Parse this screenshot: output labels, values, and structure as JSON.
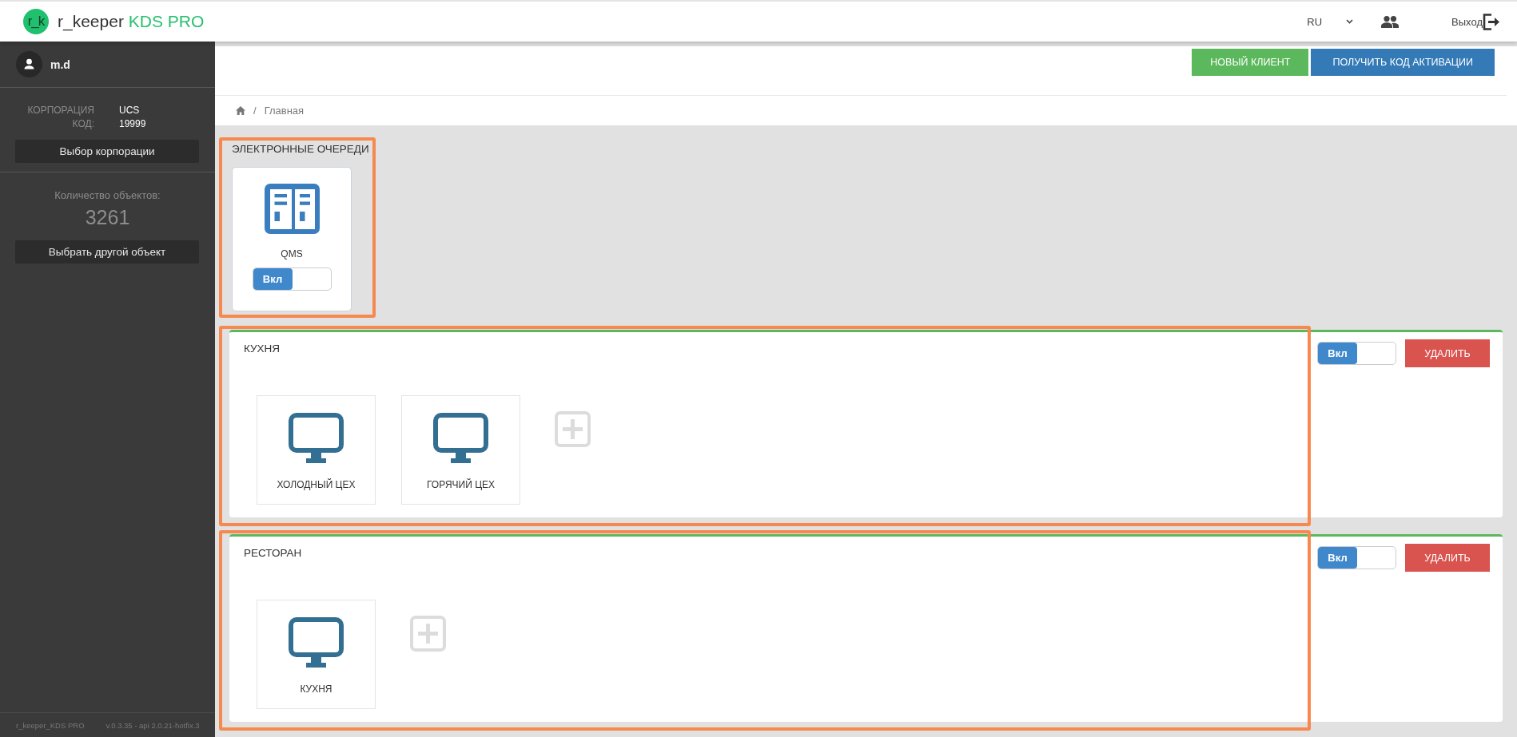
{
  "header": {
    "logo": {
      "mark": "r_k",
      "name": "r_keeper",
      "product": "KDS PRO"
    },
    "language": "RU",
    "logout": "Выход"
  },
  "sidebar": {
    "user": "m.d",
    "info": [
      {
        "label": "КОРПОРАЦИЯ",
        "value": "UCS"
      },
      {
        "label": "КОД:",
        "value": "19999"
      }
    ],
    "corporation_button": "Выбор корпорации",
    "objects_label": "Количество объектов:",
    "objects_count": "3261",
    "object_button": "Выбрать другой объект",
    "footer": {
      "app": "r_keeper_KDS PRO",
      "version": "v.0.3.35 - api 2.0.21-hotfix.3"
    }
  },
  "toolbar": {
    "buttons": [
      {
        "label": "НОВЫЙ КЛИЕНТ",
        "kind": "success"
      },
      {
        "label": "ПОЛУЧИТЬ КОД АКТИВАЦИИ",
        "kind": "primary"
      }
    ]
  },
  "breadcrumb": {
    "separator": "/",
    "items": [
      "Главная"
    ]
  },
  "queues": {
    "title": "ЭЛЕКТРОННЫЕ ОЧЕРЕДИ",
    "highlighted": true,
    "items": [
      {
        "name": "QMS",
        "toggle": {
          "label": "Вкл",
          "on": true
        }
      }
    ]
  },
  "groups": [
    {
      "title": "КУХНЯ",
      "highlighted": true,
      "toggle": {
        "label": "Вкл",
        "on": true
      },
      "delete": "УДАЛИТЬ",
      "devices": [
        {
          "name": "ХОЛОДНЫЙ ЦЕХ"
        },
        {
          "name": "ГОРЯЧИЙ ЦЕХ"
        }
      ]
    },
    {
      "title": "РЕСТОРАН",
      "highlighted": true,
      "toggle": {
        "label": "Вкл",
        "on": true
      },
      "delete": "УДАЛИТЬ",
      "devices": [
        {
          "name": "КУХНЯ"
        }
      ]
    }
  ]
}
